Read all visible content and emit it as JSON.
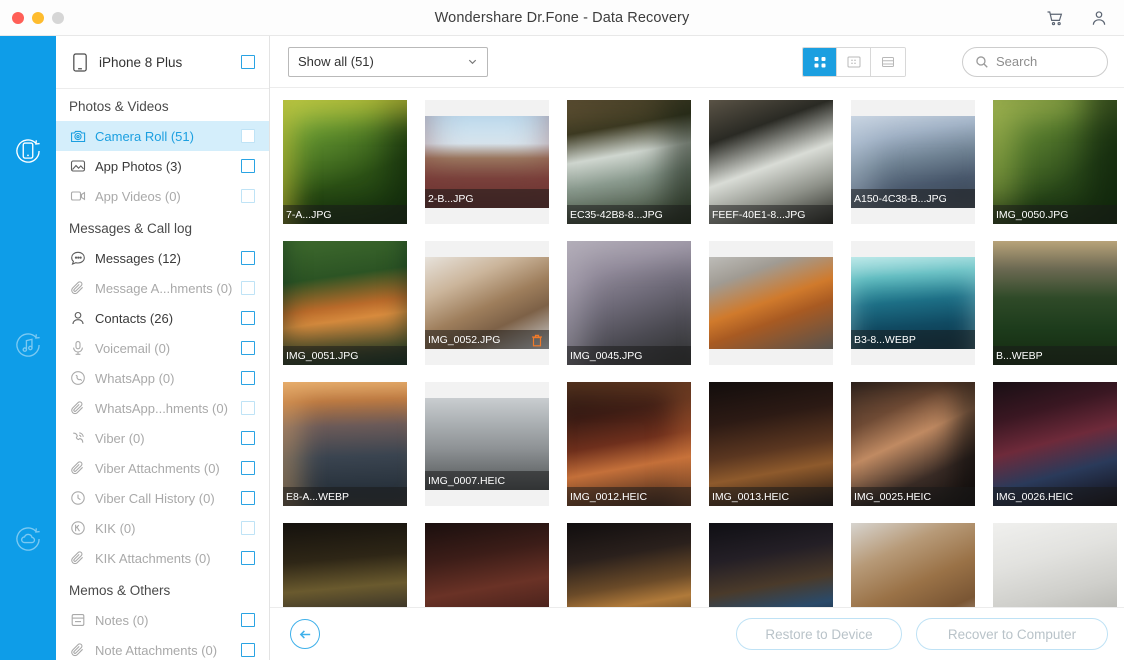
{
  "window": {
    "title": "Wondershare Dr.Fone - Data Recovery",
    "traffic_lights": [
      "close",
      "minimize",
      "maximize"
    ],
    "actions": [
      {
        "name": "cart-icon",
        "label": "Cart"
      },
      {
        "name": "account-icon",
        "label": "Account"
      }
    ]
  },
  "rail": {
    "items": [
      {
        "name": "recover-from-device",
        "icon": "device-recover-icon",
        "active": true
      },
      {
        "name": "recover-music",
        "icon": "music-recover-icon",
        "active": false
      },
      {
        "name": "recover-from-cloud",
        "icon": "cloud-recover-icon",
        "active": false
      }
    ]
  },
  "sidebar": {
    "device": {
      "name": "iPhone 8 Plus",
      "icon": "phone-icon",
      "checked": false
    },
    "groups": [
      {
        "title": "Photos & Videos",
        "items": [
          {
            "label": "Camera Roll (51)",
            "icon": "camera-icon",
            "selected": true,
            "zero": false,
            "checkbox": "faint"
          },
          {
            "label": "App Photos (3)",
            "icon": "photo-icon",
            "selected": false,
            "zero": false,
            "checkbox": "normal"
          },
          {
            "label": "App Videos (0)",
            "icon": "video-icon",
            "selected": false,
            "zero": true,
            "checkbox": "faint"
          }
        ]
      },
      {
        "title": "Messages & Call log",
        "items": [
          {
            "label": "Messages (12)",
            "icon": "message-icon",
            "selected": false,
            "zero": false,
            "checkbox": "normal"
          },
          {
            "label": "Message A...hments (0)",
            "icon": "attachment-icon",
            "selected": false,
            "zero": true,
            "checkbox": "faint"
          },
          {
            "label": "Contacts (26)",
            "icon": "contact-icon",
            "selected": false,
            "zero": false,
            "checkbox": "normal"
          },
          {
            "label": "Voicemail (0)",
            "icon": "voicemail-icon",
            "selected": false,
            "zero": true,
            "checkbox": "normal"
          },
          {
            "label": "WhatsApp (0)",
            "icon": "whatsapp-icon",
            "selected": false,
            "zero": true,
            "checkbox": "normal"
          },
          {
            "label": "WhatsApp...hments (0)",
            "icon": "attachment-icon",
            "selected": false,
            "zero": true,
            "checkbox": "faint"
          },
          {
            "label": "Viber (0)",
            "icon": "viber-icon",
            "selected": false,
            "zero": true,
            "checkbox": "normal"
          },
          {
            "label": "Viber Attachments (0)",
            "icon": "attachment-icon",
            "selected": false,
            "zero": true,
            "checkbox": "normal"
          },
          {
            "label": "Viber Call History (0)",
            "icon": "clock-icon",
            "selected": false,
            "zero": true,
            "checkbox": "normal"
          },
          {
            "label": "KIK (0)",
            "icon": "kik-icon",
            "selected": false,
            "zero": true,
            "checkbox": "faint"
          },
          {
            "label": "KIK Attachments (0)",
            "icon": "attachment-icon",
            "selected": false,
            "zero": true,
            "checkbox": "normal"
          }
        ]
      },
      {
        "title": "Memos & Others",
        "items": [
          {
            "label": "Notes (0)",
            "icon": "notes-icon",
            "selected": false,
            "zero": true,
            "checkbox": "normal"
          },
          {
            "label": "Note Attachments (0)",
            "icon": "attachment-icon",
            "selected": false,
            "zero": true,
            "checkbox": "normal"
          }
        ]
      }
    ]
  },
  "toolbar": {
    "filter_value": "Show all (51)",
    "filter_icon": "chevron-down-icon",
    "views": [
      {
        "name": "grid-view",
        "icon": "grid-icon",
        "active": true
      },
      {
        "name": "detail-view",
        "icon": "list-dots-icon",
        "active": false
      },
      {
        "name": "list-view",
        "icon": "list-icon",
        "active": false
      }
    ],
    "search_placeholder": "Search",
    "search_value": "",
    "search_icon": "search-icon"
  },
  "grid": {
    "items": [
      {
        "caption": "7-A...JPG",
        "style": "leaf",
        "deleted": false,
        "letterbox": false
      },
      {
        "caption": "2-B...JPG",
        "style": "dune",
        "deleted": false,
        "letterbox": true
      },
      {
        "caption": "EC35-42B8-8...JPG",
        "style": "waterfall",
        "deleted": false,
        "letterbox": false
      },
      {
        "caption": "FEEF-40E1-8...JPG",
        "style": "cascade",
        "deleted": false,
        "letterbox": false
      },
      {
        "caption": "A150-4C38-B...JPG",
        "style": "bigfalls",
        "deleted": false,
        "letterbox": true
      },
      {
        "caption": "IMG_0050.JPG",
        "style": "cat-tree",
        "deleted": false,
        "letterbox": false
      },
      {
        "caption": "IMG_0051.JPG",
        "style": "tiger",
        "deleted": false,
        "letterbox": false
      },
      {
        "caption": "IMG_0052.JPG",
        "style": "catface",
        "deleted": true,
        "letterbox": true
      },
      {
        "caption": "IMG_0045.JPG",
        "style": "thistle",
        "deleted": false,
        "letterbox": false
      },
      {
        "caption": "",
        "style": "bird",
        "deleted": false,
        "letterbox": true
      },
      {
        "caption": "B3-8...WEBP",
        "style": "wave",
        "deleted": false,
        "letterbox": true
      },
      {
        "caption": "B...WEBP",
        "style": "field",
        "deleted": false,
        "letterbox": false
      },
      {
        "caption": "E8-A...WEBP",
        "style": "mountain",
        "deleted": false,
        "letterbox": false
      },
      {
        "caption": "IMG_0007.HEIC",
        "style": "city",
        "deleted": false,
        "letterbox": true
      },
      {
        "caption": "IMG_0012.HEIC",
        "style": "street-red",
        "deleted": false,
        "letterbox": false
      },
      {
        "caption": "IMG_0013.HEIC",
        "style": "street-dark",
        "deleted": false,
        "letterbox": false
      },
      {
        "caption": "IMG_0025.HEIC",
        "style": "portrait",
        "deleted": false,
        "letterbox": false
      },
      {
        "caption": "IMG_0026.HEIC",
        "style": "night-city",
        "deleted": false,
        "letterbox": false
      },
      {
        "caption": "",
        "style": "night-park",
        "deleted": false,
        "letterbox": false
      },
      {
        "caption": "",
        "style": "night-building",
        "deleted": false,
        "letterbox": false
      },
      {
        "caption": "",
        "style": "night-alley",
        "deleted": false,
        "letterbox": false
      },
      {
        "caption": "",
        "style": "night-blue",
        "deleted": false,
        "letterbox": false
      },
      {
        "caption": "",
        "style": "horse",
        "deleted": false,
        "letterbox": false
      },
      {
        "caption": "",
        "style": "interior",
        "deleted": false,
        "letterbox": false
      }
    ]
  },
  "bottom": {
    "back_icon": "arrow-left-icon",
    "restore_label": "Restore to Device",
    "recover_label": "Recover to Computer"
  },
  "colors": {
    "accent": "#0e9de8",
    "selection": "#d4eefb",
    "link": "#1b9fe0",
    "deleted_marker": "#ef7a2a"
  }
}
